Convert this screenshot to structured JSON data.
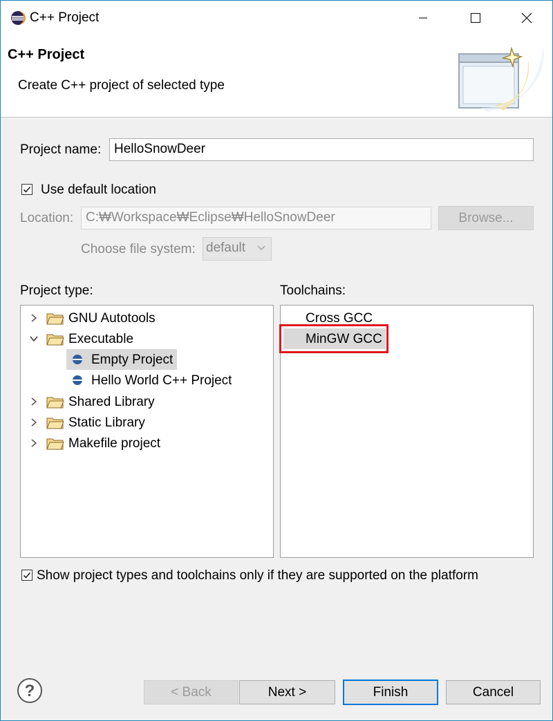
{
  "window": {
    "title": "C++ Project"
  },
  "header": {
    "title": "C++ Project",
    "subtitle": "Create C++ project of selected type"
  },
  "project_name": {
    "label": "Project name:",
    "value": "HelloSnowDeer"
  },
  "use_default_location": {
    "label": "Use default location",
    "checked": true
  },
  "location": {
    "label": "Location:",
    "value": "C:₩Workspace₩Eclipse₩HelloSnowDeer",
    "browse_label": "Browse..."
  },
  "file_system": {
    "label": "Choose file system:",
    "value": "default"
  },
  "project_types": {
    "label": "Project type:",
    "items": [
      {
        "label": "GNU Autotools",
        "expanded": false
      },
      {
        "label": "Executable",
        "expanded": true
      },
      {
        "label": "Empty Project",
        "selected": true
      },
      {
        "label": "Hello World C++ Project",
        "selected": false
      },
      {
        "label": "Shared Library",
        "expanded": false
      },
      {
        "label": "Static Library",
        "expanded": false
      },
      {
        "label": "Makefile project",
        "expanded": false
      }
    ]
  },
  "toolchains": {
    "label": "Toolchains:",
    "items": [
      {
        "label": "Cross GCC",
        "selected": false
      },
      {
        "label": "MinGW GCC",
        "selected": true
      }
    ]
  },
  "show_supported": {
    "label": "Show project types and toolchains only if they are supported on the platform",
    "checked": true
  },
  "buttons": {
    "back": "< Back",
    "next": "Next >",
    "finish": "Finish",
    "cancel": "Cancel"
  },
  "colors": {
    "accent": "#0078d7",
    "highlight": "#e0151f",
    "window_border": "#1b86b9"
  }
}
